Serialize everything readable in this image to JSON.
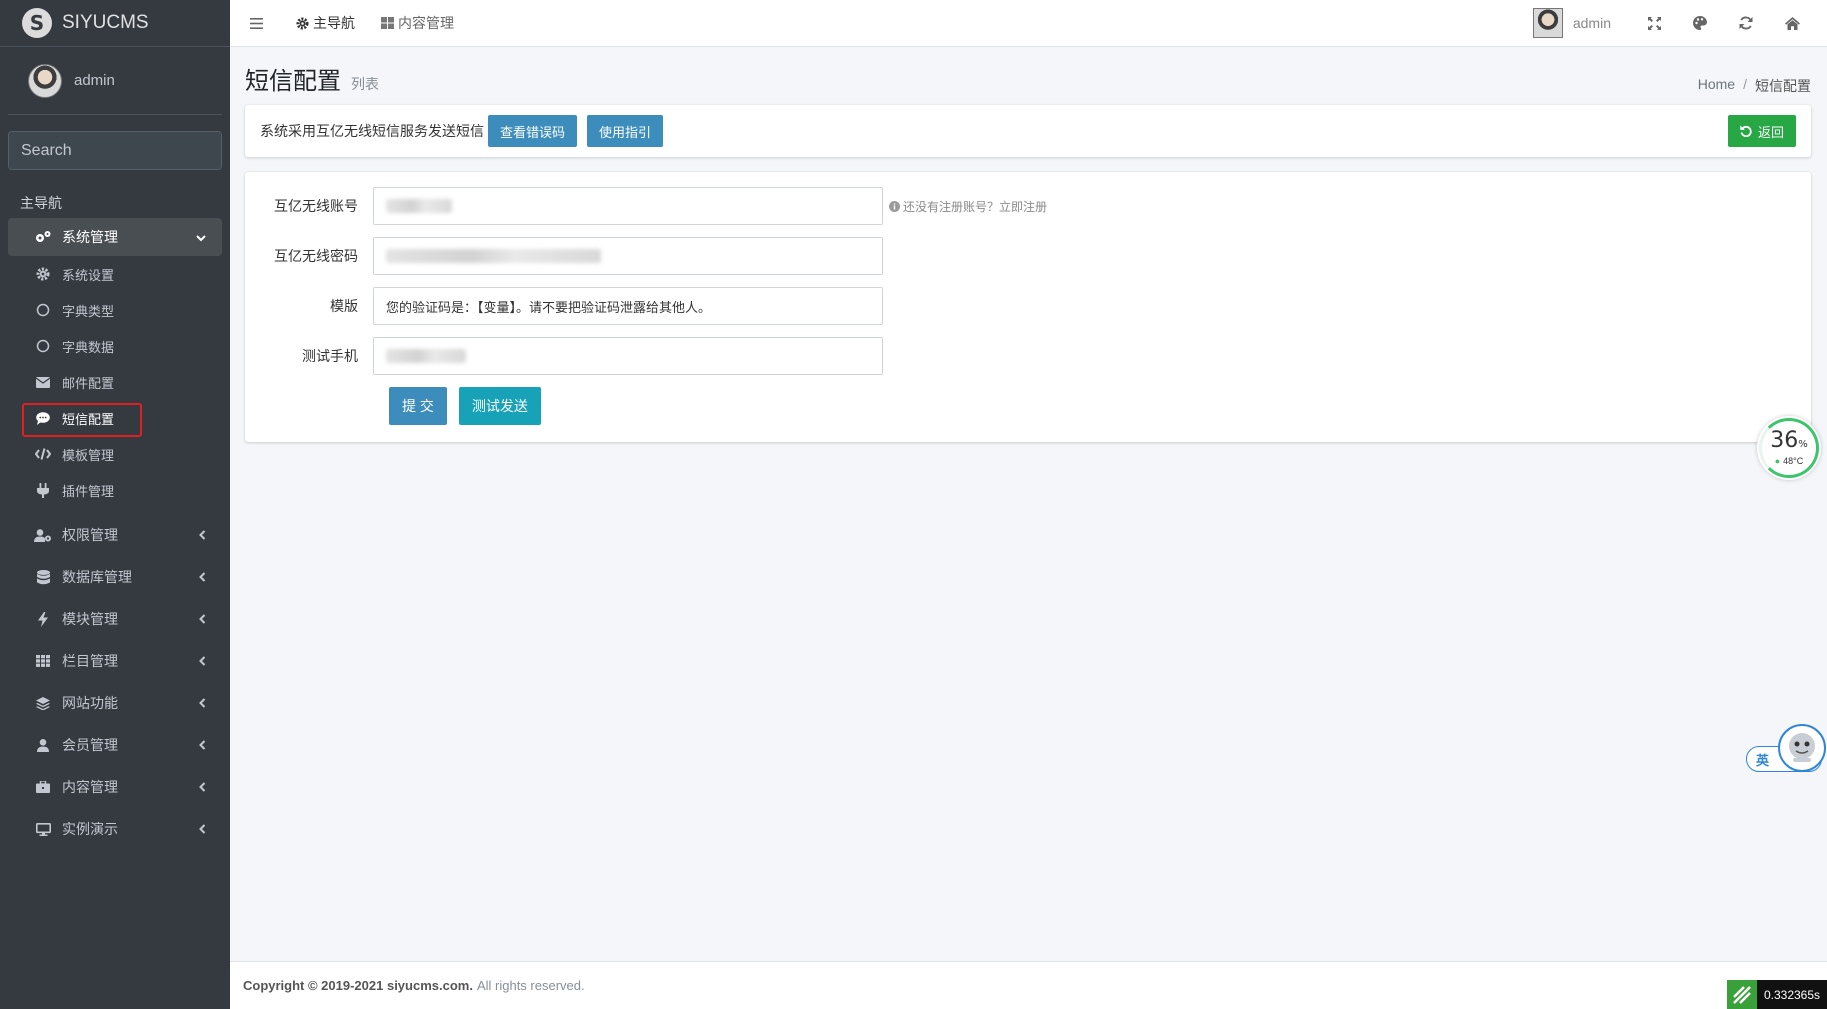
{
  "brand": {
    "logo": "S",
    "name": "SIYUCMS"
  },
  "user": {
    "name": "admin"
  },
  "search": {
    "placeholder": "Search"
  },
  "sidebar": {
    "header": "主导航",
    "system": {
      "label": "系统管理",
      "items": [
        {
          "label": "系统设置",
          "icon": "gear-icon"
        },
        {
          "label": "字典类型",
          "icon": "circle-icon"
        },
        {
          "label": "字典数据",
          "icon": "circle-icon"
        },
        {
          "label": "邮件配置",
          "icon": "envelope-icon"
        },
        {
          "label": "短信配置",
          "icon": "comment-icon"
        },
        {
          "label": "模板管理",
          "icon": "code-icon"
        },
        {
          "label": "插件管理",
          "icon": "plug-icon"
        }
      ]
    },
    "groups": [
      {
        "label": "权限管理",
        "icon": "user-cog-icon"
      },
      {
        "label": "数据库管理",
        "icon": "database-icon"
      },
      {
        "label": "模块管理",
        "icon": "bolt-icon"
      },
      {
        "label": "栏目管理",
        "icon": "grid-icon"
      },
      {
        "label": "网站功能",
        "icon": "layers-icon"
      },
      {
        "label": "会员管理",
        "icon": "user-icon"
      },
      {
        "label": "内容管理",
        "icon": "briefcase-icon"
      },
      {
        "label": "实例演示",
        "icon": "desktop-icon"
      }
    ]
  },
  "topbar": {
    "nav_main": "主导航",
    "nav_content": "内容管理",
    "user": "admin"
  },
  "page": {
    "title": "短信配置",
    "subtitle": "列表",
    "breadcrumb": [
      "Home",
      "/",
      "短信配置"
    ]
  },
  "info": {
    "text": "系统采用互亿无线短信服务发送短信",
    "btn_errors": "查看错误码",
    "btn_guide": "使用指引",
    "btn_back": "返回"
  },
  "form": {
    "account_label": "互亿无线账号",
    "account_help": "还没有注册账号？立即注册",
    "password_label": "互亿无线密码",
    "template_label": "模版",
    "template_value": "您的验证码是：【变量】。请不要把验证码泄露给其他人。",
    "phone_label": "测试手机",
    "submit_label": "提 交",
    "test_label": "测试发送"
  },
  "footer": {
    "copyright": "Copyright © 2019-2021 siyucms.com.",
    "rights": "All rights reserved."
  },
  "widgets": {
    "cpu_percent": "36",
    "cpu_unit": "%",
    "temp": "48°C",
    "ime": "英",
    "timer": "0.332365s"
  }
}
